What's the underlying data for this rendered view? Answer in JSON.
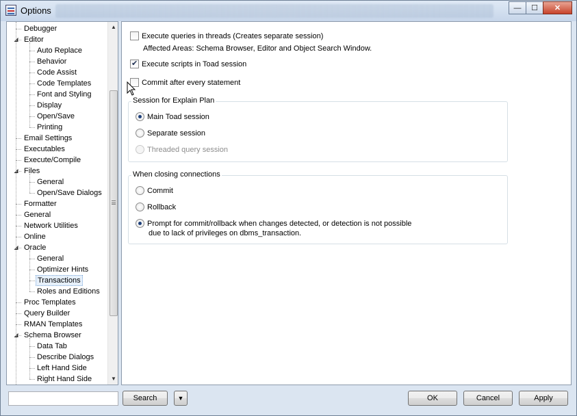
{
  "window": {
    "title": "Options",
    "caption_buttons": {
      "minimize": "—",
      "maximize": "☐",
      "close": "✕"
    }
  },
  "tree": {
    "items": [
      {
        "label": "Debugger",
        "level": 0
      },
      {
        "label": "Editor",
        "level": 0,
        "expanded": true
      },
      {
        "label": "Auto Replace",
        "level": 1
      },
      {
        "label": "Behavior",
        "level": 1
      },
      {
        "label": "Code Assist",
        "level": 1
      },
      {
        "label": "Code Templates",
        "level": 1
      },
      {
        "label": "Font and Styling",
        "level": 1
      },
      {
        "label": "Display",
        "level": 1
      },
      {
        "label": "Open/Save",
        "level": 1
      },
      {
        "label": "Printing",
        "level": 1
      },
      {
        "label": "Email Settings",
        "level": 0
      },
      {
        "label": "Executables",
        "level": 0
      },
      {
        "label": "Execute/Compile",
        "level": 0
      },
      {
        "label": "Files",
        "level": 0,
        "expanded": true
      },
      {
        "label": "General",
        "level": 1
      },
      {
        "label": "Open/Save Dialogs",
        "level": 1
      },
      {
        "label": "Formatter",
        "level": 0
      },
      {
        "label": "General",
        "level": 0
      },
      {
        "label": "Network Utilities",
        "level": 0
      },
      {
        "label": "Online",
        "level": 0
      },
      {
        "label": "Oracle",
        "level": 0,
        "expanded": true
      },
      {
        "label": "General",
        "level": 1
      },
      {
        "label": "Optimizer Hints",
        "level": 1
      },
      {
        "label": "Transactions",
        "level": 1,
        "selected": true
      },
      {
        "label": "Roles and Editions",
        "level": 1
      },
      {
        "label": "Proc Templates",
        "level": 0
      },
      {
        "label": "Query Builder",
        "level": 0
      },
      {
        "label": "RMAN Templates",
        "level": 0
      },
      {
        "label": "Schema Browser",
        "level": 0,
        "expanded": true
      },
      {
        "label": "Data Tab",
        "level": 1
      },
      {
        "label": "Describe Dialogs",
        "level": 1
      },
      {
        "label": "Left Hand Side",
        "level": 1
      },
      {
        "label": "Right Hand Side",
        "level": 1
      }
    ]
  },
  "content": {
    "exec_threads": {
      "label": "Execute queries in threads (Creates separate session)",
      "checked": false
    },
    "affected_areas": "Affected Areas: Schema Browser, Editor and Object Search Window.",
    "exec_scripts": {
      "label": "Execute scripts in Toad session",
      "checked": true
    },
    "commit_every": {
      "label": "Commit after every statement",
      "checked": false
    },
    "explain_plan": {
      "legend": "Session for Explain Plan",
      "options": [
        {
          "label": "Main Toad session",
          "checked": true,
          "disabled": false
        },
        {
          "label": "Separate session",
          "checked": false,
          "disabled": false
        },
        {
          "label": "Threaded query session",
          "checked": false,
          "disabled": true
        }
      ]
    },
    "closing": {
      "legend": "When closing connections",
      "commit": "Commit",
      "rollback": "Rollback",
      "prompt_line1": "Prompt for commit/rollback when changes detected, or detection is not possible",
      "prompt_line2": "due to lack of privileges on dbms_transaction.",
      "selected": "prompt"
    }
  },
  "bottom": {
    "search_value": "",
    "search_button": "Search",
    "dropdown_glyph": "▼",
    "ok": "OK",
    "cancel": "Cancel",
    "apply": "Apply"
  }
}
